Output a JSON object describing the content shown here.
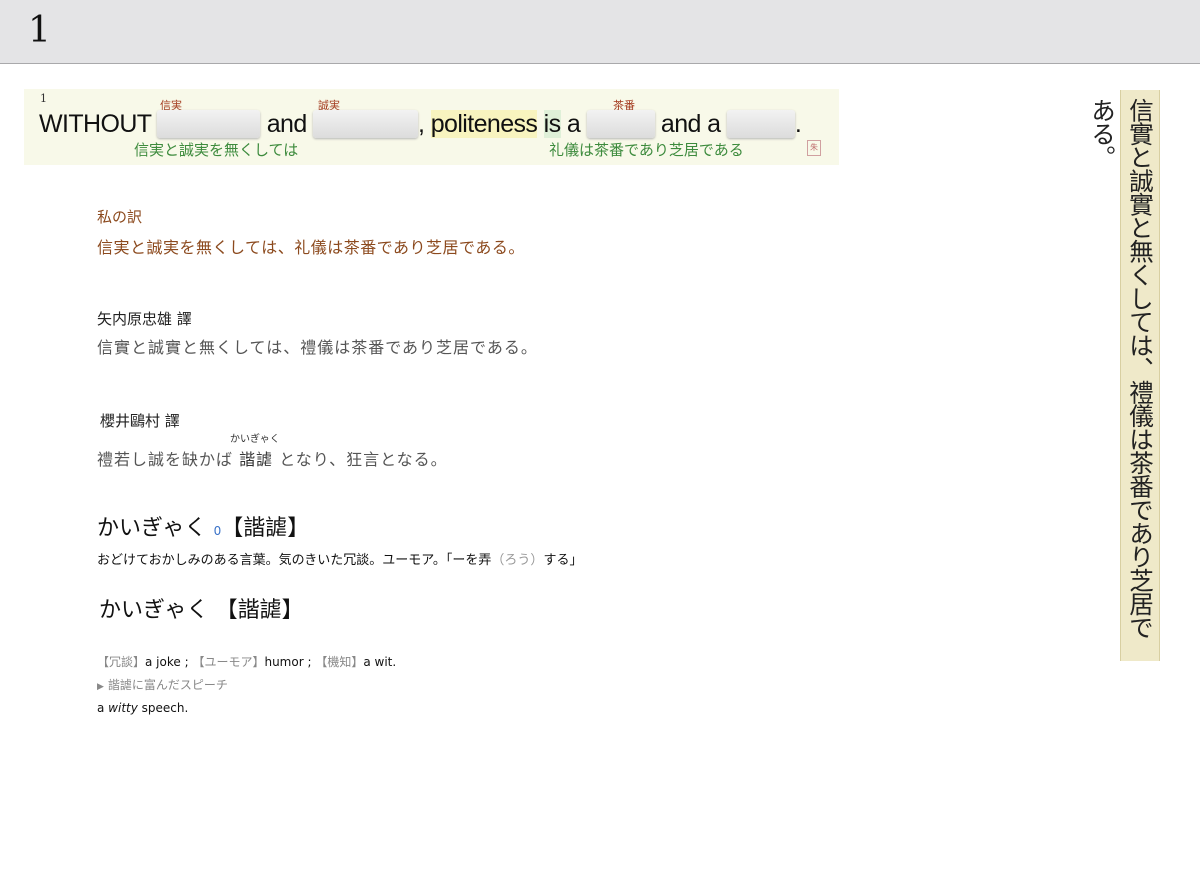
{
  "page": {
    "number": "1"
  },
  "sentence": {
    "index": "1",
    "glosses": [
      "信実",
      "誠実",
      "茶番"
    ],
    "words": {
      "without": "WITHOUT",
      "and1": "and",
      "comma": ",",
      "politeness": "politeness",
      "is": "is",
      "a1": "a",
      "and_a": "and a",
      "period": "."
    },
    "translation_left": "信実と誠実を無くしては",
    "translation_right": "礼儀は茶番であり芝居である",
    "stamp": "朱"
  },
  "my_translation": {
    "label": "私の訳",
    "text": "信実と誠実を無くしては、礼儀は茶番であり芝居である。"
  },
  "yanaihara": {
    "label": "矢内原忠雄 譯",
    "text": "信實と誠實と無くしては、禮儀は茶番であり芝居である。"
  },
  "sakurai": {
    "label": "櫻井鷗村 譯",
    "ruby": "かいぎゃく",
    "text_before": "禮若し誠を缺かば",
    "ruby_base": "諧謔",
    "text_after": "となり、狂言となる。"
  },
  "dict1": {
    "headword": "かいぎゃく",
    "accent": "0",
    "kanji": "【諧謔】",
    "def_main": "おどけておかしみのある言葉。気のきいた冗談。ユーモア。「ーを弄",
    "def_paren": "（ろう）",
    "def_end": "する」"
  },
  "dict2": {
    "headword": "かいぎゃく",
    "kanji": "【諧謔】",
    "senses": [
      {
        "tag": "【冗談】",
        "en": "a joke ;"
      },
      {
        "tag": "【ユーモア】",
        "en": "humor ;"
      },
      {
        "tag": "【機知】",
        "en": "a wit."
      }
    ],
    "example_ja": "諧謔に富んだスピーチ",
    "example_en_pre": "a ",
    "example_en_em": "witty",
    "example_en_post": " speech."
  },
  "vertical_scroll": {
    "text": "信實と誠實と無くしては、禮儀は茶番であり芝居である。"
  }
}
